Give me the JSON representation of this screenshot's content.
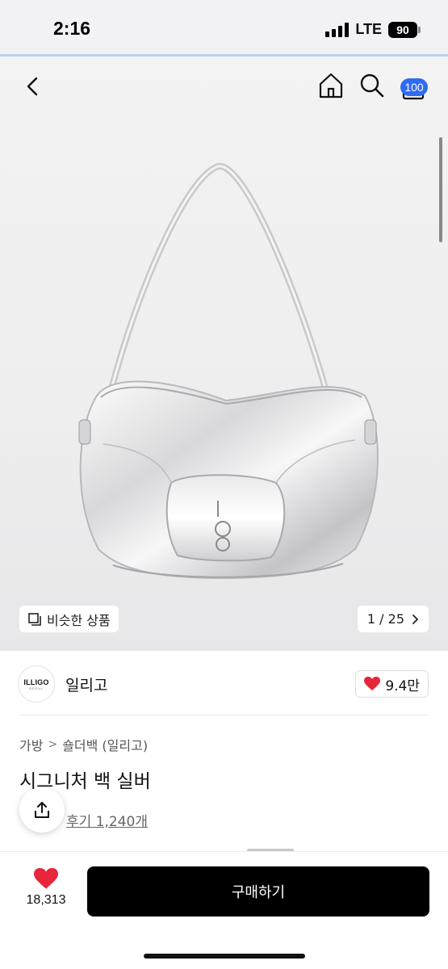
{
  "status": {
    "time": "2:16",
    "network": "LTE",
    "battery": "90"
  },
  "header": {
    "cart_badge": "100"
  },
  "gallery": {
    "similar_label": "비슷한 상품",
    "page_indicator": "1 / 25"
  },
  "brand": {
    "logo_text": "ILLIGO",
    "logo_sub": "SEOUL",
    "name": "일리고",
    "likes": "9.4만"
  },
  "product": {
    "breadcrumb": [
      "가방",
      "숄더백 (일리고)"
    ],
    "title": "시그니처 백 실버",
    "reviews": "후기 1,240개"
  },
  "bottom": {
    "wish_count": "18,313",
    "buy_label": "구매하기"
  },
  "colors": {
    "accent_badge": "#2f6bf2",
    "heart": "#e8253a",
    "buy_button": "#000000"
  },
  "icons": [
    "back-icon",
    "home-icon",
    "search-icon",
    "cart-icon",
    "similar-icon",
    "chevron-right-icon",
    "heart-icon",
    "share-icon"
  ]
}
